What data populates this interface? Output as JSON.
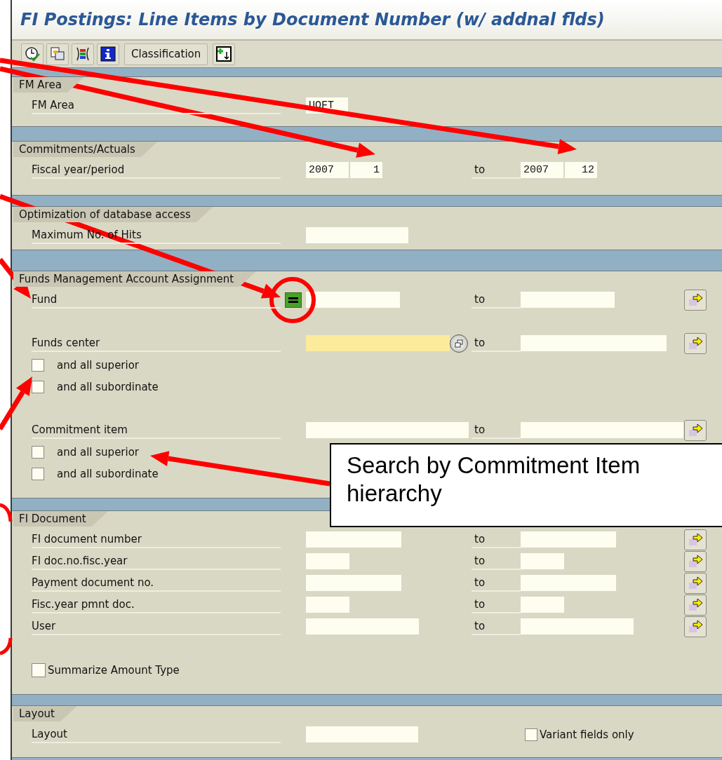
{
  "window": {
    "title": "FI Postings: Line Items by Document Number (w/ addnal flds)"
  },
  "toolbar": [
    {
      "kind": "execute"
    },
    {
      "kind": "copy"
    },
    {
      "kind": "colors"
    },
    {
      "kind": "info"
    },
    {
      "kind": "text",
      "label": "Classification"
    },
    {
      "kind": "import"
    }
  ],
  "sections": [
    {
      "title": "FM Area",
      "rows": [
        {
          "kind": "field",
          "label": "FM Area",
          "value": "UOFT",
          "highlighted": false,
          "option_set": false,
          "hierarchy_help": false
        }
      ]
    },
    {
      "title": "Commitments/Actuals",
      "rows": [
        {
          "kind": "period",
          "label": "Fiscal year/period",
          "values": [
            "2007",
            "1"
          ],
          "to_label": "to",
          "to_values": [
            "2007",
            "12"
          ]
        }
      ]
    },
    {
      "title": "Optimization of database access",
      "rows": [
        {
          "kind": "field",
          "label": "Maximum No. of Hits",
          "highlighted": false,
          "option_set": false,
          "hierarchy_help": false
        }
      ]
    },
    {
      "title": "Funds Management Account Assignment",
      "rows": [
        {
          "kind": "field",
          "label": "Fund",
          "to_label": "to",
          "multi_select": true,
          "highlighted": false,
          "option_set": true,
          "hierarchy_help": false
        },
        {
          "kind": "blank"
        },
        {
          "kind": "field",
          "label": "Funds center",
          "to_label": "to",
          "multi_select": true,
          "highlighted": true,
          "option_set": false,
          "hierarchy_help": true
        },
        {
          "kind": "checkbox",
          "label": "and all superior",
          "checked": false
        },
        {
          "kind": "checkbox",
          "label": "and all subordinate",
          "checked": false
        },
        {
          "kind": "blank"
        },
        {
          "kind": "field",
          "label": "Commitment item",
          "to_label": "to",
          "multi_select": true,
          "highlighted": false,
          "option_set": false,
          "hierarchy_help": false
        },
        {
          "kind": "checkbox",
          "label": "and all superior",
          "checked": false
        },
        {
          "kind": "checkbox",
          "label": "and all subordinate",
          "checked": false
        }
      ]
    },
    {
      "title": "FI Document",
      "rows": [
        {
          "kind": "field",
          "label": "FI document number",
          "to_label": "to",
          "multi_select": true,
          "highlighted": false,
          "option_set": false,
          "hierarchy_help": false
        },
        {
          "kind": "field",
          "label": "FI doc.no.fisc.year",
          "to_label": "to",
          "multi_select": true,
          "highlighted": false,
          "option_set": false,
          "hierarchy_help": false
        },
        {
          "kind": "field",
          "label": "Payment document no.",
          "to_label": "to",
          "multi_select": true,
          "highlighted": false,
          "option_set": false,
          "hierarchy_help": false
        },
        {
          "kind": "field",
          "label": "Fisc.year pmnt doc.",
          "to_label": "to",
          "multi_select": true,
          "highlighted": false,
          "option_set": false,
          "hierarchy_help": false
        },
        {
          "kind": "field",
          "label": "User",
          "to_label": "to",
          "multi_select": true,
          "highlighted": false,
          "option_set": false,
          "hierarchy_help": false
        },
        {
          "kind": "blank"
        },
        {
          "kind": "checkbox_tight",
          "label": "Summarize Amount Type",
          "checked": false
        }
      ]
    },
    {
      "title": "Layout",
      "rows": [
        {
          "kind": "field",
          "label": "Layout",
          "highlighted": false,
          "option_set": false,
          "hierarchy_help": false,
          "side_checkbox": {
            "label": "Variant fields only",
            "checked": false
          }
        }
      ]
    }
  ],
  "callout": {
    "text": "Search by Commitment Item hierarchy"
  }
}
